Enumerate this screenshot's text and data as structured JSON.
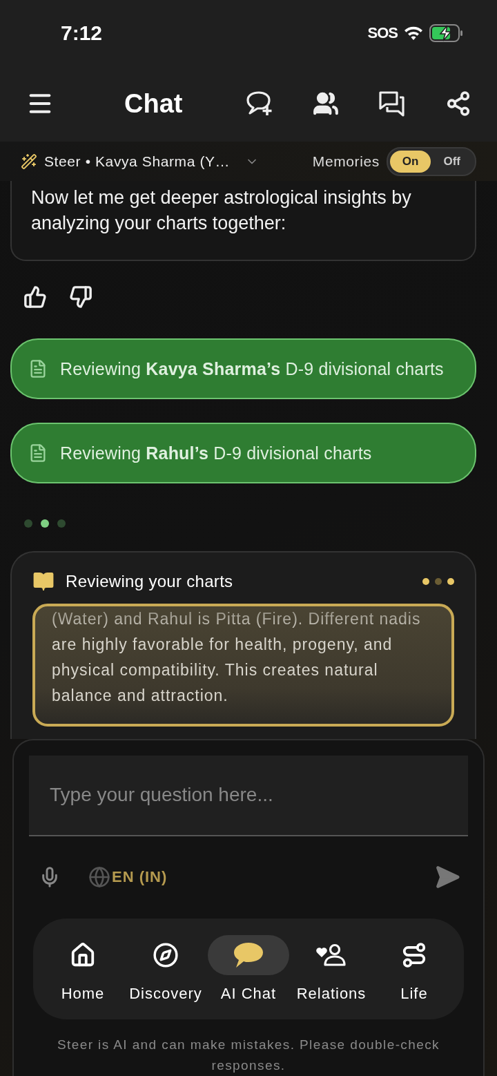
{
  "status_bar": {
    "time": "7:12",
    "carrier": "SOS"
  },
  "header": {
    "title": "Chat"
  },
  "context_bar": {
    "label": "Steer • Kavya Sharma (Y…",
    "memories_label": "Memories",
    "memories_options": [
      {
        "label": "On",
        "selected": true
      },
      {
        "label": "Off",
        "selected": false
      }
    ]
  },
  "message": {
    "text": "Now let me get deeper astrological insights by analyzing your charts together:"
  },
  "tool_calls": [
    {
      "text": "Reviewing **Kavya Sharma’s** D-9 divisional charts"
    },
    {
      "text": "Reviewing **Rahul’s** D-9 divisional charts"
    }
  ],
  "typing_dots": [
    {
      "active": false
    },
    {
      "active": true
    },
    {
      "active": false
    }
  ],
  "reasoning_card": {
    "title": "Reviewing your charts",
    "dots": [
      {
        "active": true
      },
      {
        "active": false
      },
      {
        "active": true
      }
    ],
    "text": "(Water) and Rahul is Pitta (Fire). Different nadis are highly favorable for health, progeny, and physical compatibility. This creates natural balance and attraction."
  },
  "composer": {
    "placeholder": "Type your question here...",
    "language": "EN (IN)"
  },
  "nav": [
    {
      "label": "Home",
      "selected": false
    },
    {
      "label": "Discovery",
      "selected": false
    },
    {
      "label": "AI Chat",
      "selected": true
    },
    {
      "label": "Relations",
      "selected": false
    },
    {
      "label": "Life",
      "selected": false
    }
  ],
  "disclaimer": "Steer is AI and can make mistakes. Please double-check responses."
}
